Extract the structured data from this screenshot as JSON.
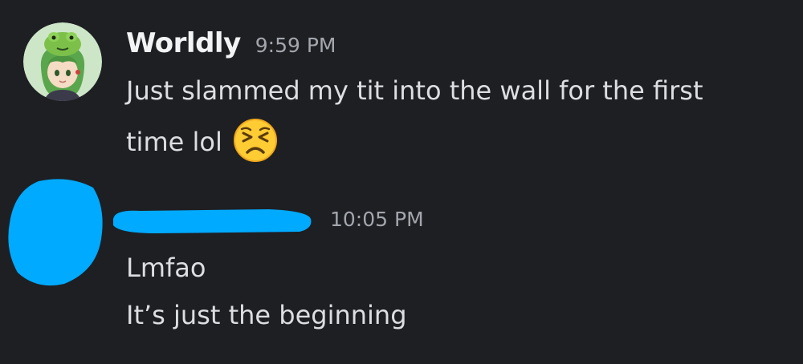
{
  "messages": [
    {
      "username": "Worldly",
      "timestamp": "9:59 PM",
      "avatar": "anime-girl-green-hair-frog-hat",
      "lines": [
        "Just slammed my tit into the wall for the first",
        "time lol"
      ],
      "emoji": "persevering-face-emoji"
    },
    {
      "username_redacted": true,
      "avatar_redacted": true,
      "redaction_color": "#00aaff",
      "timestamp": "10:05 PM",
      "lines": [
        "Lmfao",
        "It’s just the beginning"
      ]
    }
  ],
  "colors": {
    "background": "#1e1f23",
    "username": "#f2f3f5",
    "timestamp": "#a3a6ad",
    "text": "#dcdee1",
    "emoji": "#ffcc33"
  }
}
